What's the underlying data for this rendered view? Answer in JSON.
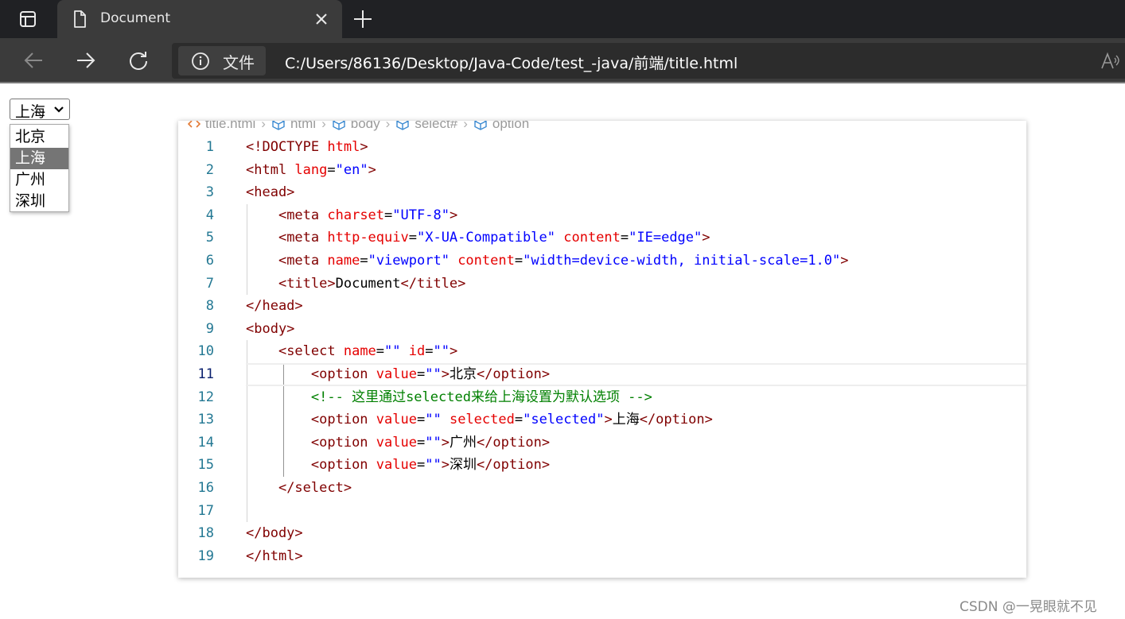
{
  "browser": {
    "tab": {
      "title": "Document"
    },
    "omnibox": {
      "site_info_label": "文件",
      "url": "C:/Users/86136/Desktop/Java-Code/test_-java/前端/title.html"
    },
    "icons": [
      "tab-actions-icon",
      "page-icon",
      "close-icon",
      "new-tab-icon",
      "back-icon",
      "forward-icon",
      "reload-icon",
      "info-icon",
      "read-aloud-icon"
    ]
  },
  "page": {
    "select": {
      "value": "上海",
      "options": [
        {
          "label": "北京",
          "selected": false
        },
        {
          "label": "上海",
          "selected": true
        },
        {
          "label": "广州",
          "selected": false
        },
        {
          "label": "深圳",
          "selected": false
        }
      ]
    }
  },
  "editor": {
    "breadcrumbs": [
      "title.html",
      "html",
      "body",
      "select#",
      "option"
    ],
    "current_line": 11,
    "lines": [
      {
        "n": "1",
        "tokens": [
          [
            "t",
            "<!DOCTYPE "
          ],
          [
            "a",
            "html"
          ],
          [
            "t",
            ">"
          ]
        ]
      },
      {
        "n": "2",
        "tokens": [
          [
            "t",
            "<html "
          ],
          [
            "a",
            "lang"
          ],
          [
            "txt",
            "="
          ],
          [
            "s",
            "\"en\""
          ],
          [
            "t",
            ">"
          ]
        ]
      },
      {
        "n": "3",
        "tokens": [
          [
            "t",
            "<head>"
          ]
        ]
      },
      {
        "n": "4",
        "indent": 1,
        "tokens": [
          [
            "t",
            "<meta "
          ],
          [
            "a",
            "charset"
          ],
          [
            "txt",
            "="
          ],
          [
            "s",
            "\"UTF-8\""
          ],
          [
            "t",
            ">"
          ]
        ]
      },
      {
        "n": "5",
        "indent": 1,
        "tokens": [
          [
            "t",
            "<meta "
          ],
          [
            "a",
            "http-equiv"
          ],
          [
            "txt",
            "="
          ],
          [
            "s",
            "\"X-UA-Compatible\""
          ],
          [
            "txt",
            " "
          ],
          [
            "a",
            "content"
          ],
          [
            "txt",
            "="
          ],
          [
            "s",
            "\"IE=edge\""
          ],
          [
            "t",
            ">"
          ]
        ]
      },
      {
        "n": "6",
        "indent": 1,
        "tokens": [
          [
            "t",
            "<meta "
          ],
          [
            "a",
            "name"
          ],
          [
            "txt",
            "="
          ],
          [
            "s",
            "\"viewport\""
          ],
          [
            "txt",
            " "
          ],
          [
            "a",
            "content"
          ],
          [
            "txt",
            "="
          ],
          [
            "s",
            "\"width=device-width, initial-scale=1.0\""
          ],
          [
            "t",
            ">"
          ]
        ]
      },
      {
        "n": "7",
        "indent": 1,
        "tokens": [
          [
            "t",
            "<title>"
          ],
          [
            "txt",
            "Document"
          ],
          [
            "t",
            "</title>"
          ]
        ]
      },
      {
        "n": "8",
        "tokens": [
          [
            "t",
            "</head>"
          ]
        ]
      },
      {
        "n": "9",
        "tokens": [
          [
            "t",
            "<body>"
          ]
        ]
      },
      {
        "n": "10",
        "indent": 1,
        "tokens": [
          [
            "t",
            "<select "
          ],
          [
            "a",
            "name"
          ],
          [
            "txt",
            "="
          ],
          [
            "s",
            "\"\""
          ],
          [
            "txt",
            " "
          ],
          [
            "a",
            "id"
          ],
          [
            "txt",
            "="
          ],
          [
            "s",
            "\"\""
          ],
          [
            "t",
            ">"
          ]
        ]
      },
      {
        "n": "11",
        "indent": 2,
        "tokens": [
          [
            "t",
            "<option "
          ],
          [
            "a",
            "value"
          ],
          [
            "txt",
            "="
          ],
          [
            "s",
            "\"\""
          ],
          [
            "t",
            ">"
          ],
          [
            "txt",
            "北京"
          ],
          [
            "t",
            "</option>"
          ]
        ]
      },
      {
        "n": "12",
        "indent": 2,
        "tokens": [
          [
            "c",
            "<!-- 这里通过selected来给上海设置为默认选项 -->"
          ]
        ]
      },
      {
        "n": "13",
        "indent": 2,
        "tokens": [
          [
            "t",
            "<option "
          ],
          [
            "a",
            "value"
          ],
          [
            "txt",
            "="
          ],
          [
            "s",
            "\"\""
          ],
          [
            "txt",
            " "
          ],
          [
            "a",
            "selected"
          ],
          [
            "txt",
            "="
          ],
          [
            "s",
            "\"selected\""
          ],
          [
            "t",
            ">"
          ],
          [
            "txt",
            "上海"
          ],
          [
            "t",
            "</option>"
          ]
        ]
      },
      {
        "n": "14",
        "indent": 2,
        "tokens": [
          [
            "t",
            "<option "
          ],
          [
            "a",
            "value"
          ],
          [
            "txt",
            "="
          ],
          [
            "s",
            "\"\""
          ],
          [
            "t",
            ">"
          ],
          [
            "txt",
            "广州"
          ],
          [
            "t",
            "</option>"
          ]
        ]
      },
      {
        "n": "15",
        "indent": 2,
        "tokens": [
          [
            "t",
            "<option "
          ],
          [
            "a",
            "value"
          ],
          [
            "txt",
            "="
          ],
          [
            "s",
            "\"\""
          ],
          [
            "t",
            ">"
          ],
          [
            "txt",
            "深圳"
          ],
          [
            "t",
            "</option>"
          ]
        ]
      },
      {
        "n": "16",
        "indent": 1,
        "tokens": [
          [
            "t",
            "</select>"
          ]
        ]
      },
      {
        "n": "17",
        "indent": 1,
        "tokens": []
      },
      {
        "n": "18",
        "tokens": [
          [
            "t",
            "</body>"
          ]
        ]
      },
      {
        "n": "19",
        "tokens": [
          [
            "t",
            "</html>"
          ]
        ]
      }
    ]
  },
  "watermark": "CSDN @一晃眼就不见",
  "colors": {
    "tag": "#800000",
    "attribute": "#e50000",
    "string": "#0000ff",
    "comment": "#008000",
    "line_number": "#237893",
    "tab_bar": "#202124",
    "toolbar": "#3b3b3b",
    "dropdown_selected": "#757575"
  }
}
